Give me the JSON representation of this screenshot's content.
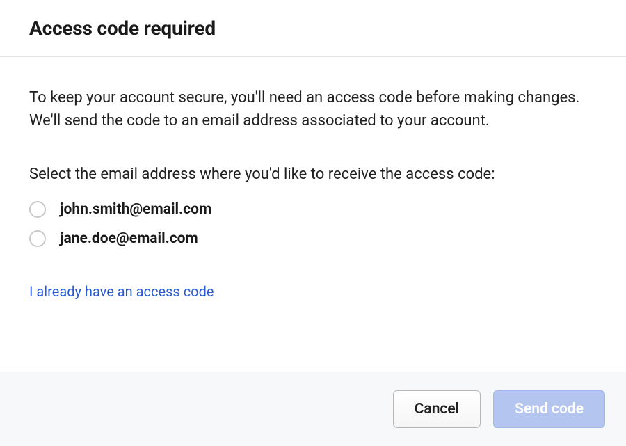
{
  "dialog": {
    "title": "Access code required",
    "description": "To keep your account secure, you'll need an access code before making changes. We'll send the code to an email address associated to your account.",
    "prompt": "Select the email address where you'd like to receive the access code:",
    "emails": [
      "john.smith@email.com",
      "jane.doe@email.com"
    ],
    "link_text": "I already have an access code",
    "buttons": {
      "cancel": "Cancel",
      "send": "Send code"
    }
  }
}
